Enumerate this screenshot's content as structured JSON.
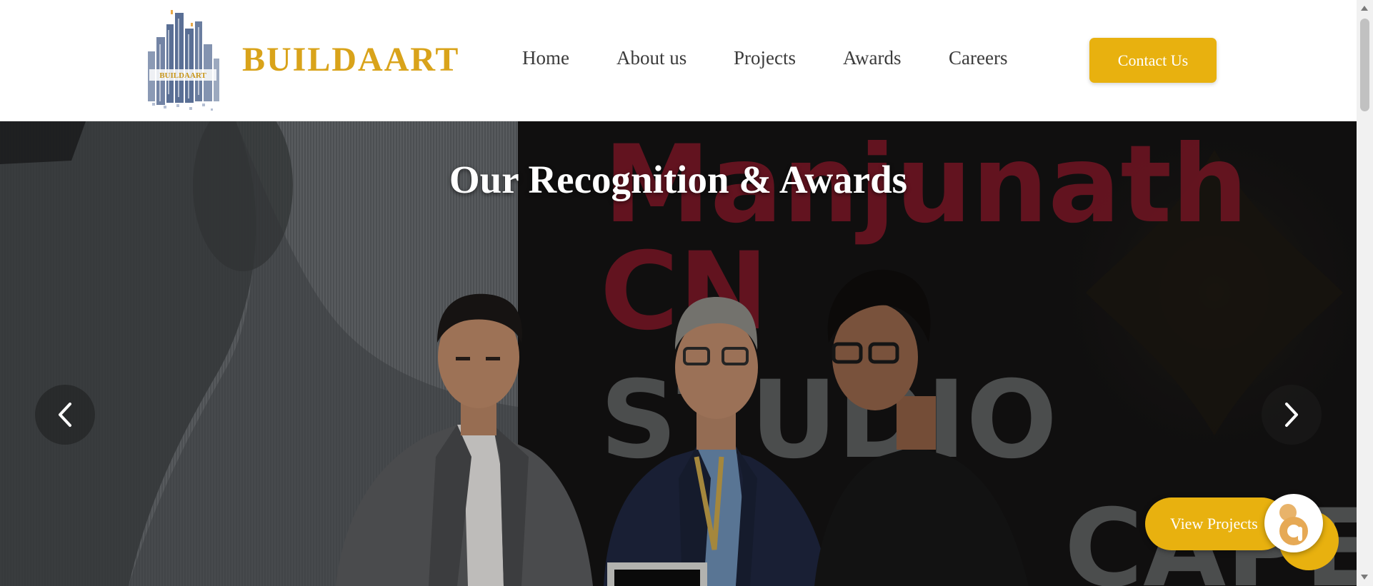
{
  "brand": {
    "name": "BUILDAART",
    "logo_text": "BUILDAART"
  },
  "nav": {
    "items": [
      {
        "label": "Home"
      },
      {
        "label": "About us"
      },
      {
        "label": "Projects"
      },
      {
        "label": "Awards"
      },
      {
        "label": "Careers"
      }
    ],
    "contact_label": "Contact Us"
  },
  "hero": {
    "title": "Our Recognition & Awards",
    "backdrop_text": {
      "line1": "Manjunath",
      "line2": "CN",
      "line3": "STUDIO",
      "line4": "CAPE"
    },
    "prev_icon": "chevron-left-icon",
    "next_icon": "chevron-right-icon",
    "view_projects_label": "View Projects"
  },
  "colors": {
    "accent": "#e8b10f",
    "brand_gold": "#d9a31a",
    "nav_text": "#3b3b3b",
    "backdrop_red": "#9c1a2e"
  }
}
